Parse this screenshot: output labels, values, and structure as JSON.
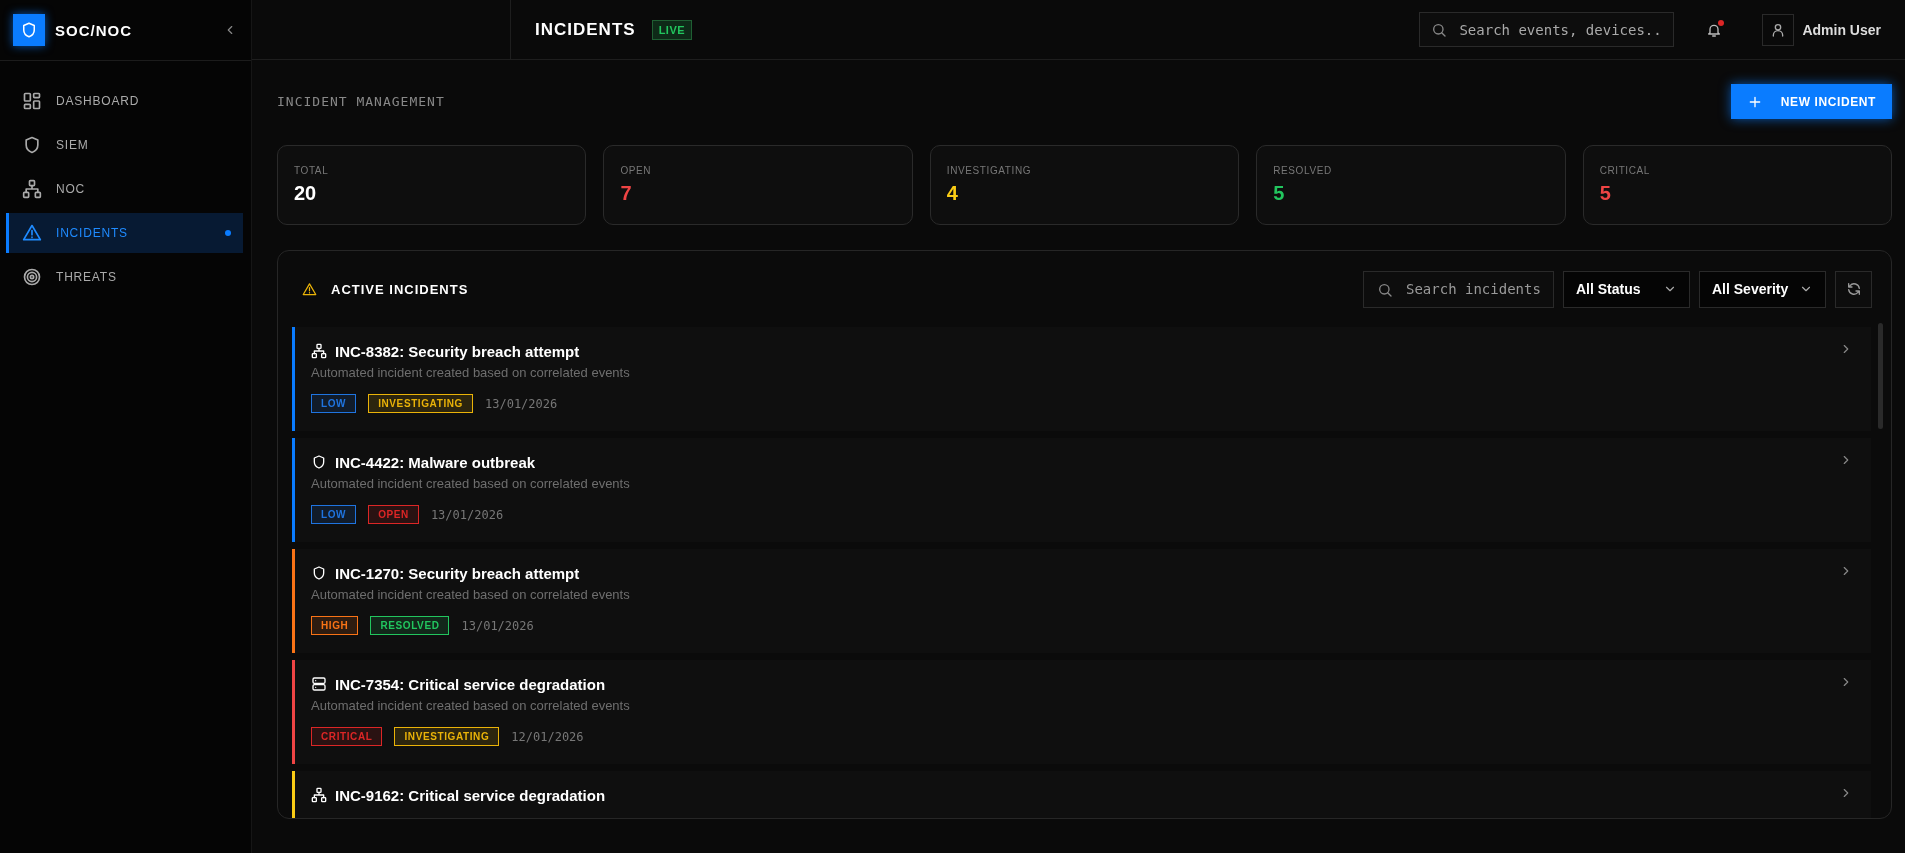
{
  "sidebar": {
    "brand": "SOC/NOC",
    "items": [
      {
        "label": "DASHBOARD",
        "selected": false
      },
      {
        "label": "SIEM",
        "selected": false
      },
      {
        "label": "NOC",
        "selected": false
      },
      {
        "label": "INCIDENTS",
        "selected": true
      },
      {
        "label": "THREATS",
        "selected": false
      }
    ]
  },
  "header": {
    "title": "INCIDENTS",
    "badge": "LIVE",
    "search": {
      "placeholder": "Search events, devices.."
    },
    "notifications": {
      "unread": true
    },
    "user": "Admin User"
  },
  "page": {
    "title": "INCIDENT MANAGEMENT",
    "action": "NEW INCIDENT"
  },
  "stats": [
    {
      "label": "TOTAL",
      "value": "20",
      "color": "#ffffff"
    },
    {
      "label": "OPEN",
      "value": "7",
      "color": "#ef4444"
    },
    {
      "label": "INVESTIGATING",
      "value": "4",
      "color": "#facc15"
    },
    {
      "label": "RESOLVED",
      "value": "5",
      "color": "#22c55e"
    },
    {
      "label": "CRITICAL",
      "value": "5",
      "color": "#ef4444"
    }
  ],
  "panel": {
    "title": "ACTIVE INCIDENTS",
    "search": {
      "placeholder": "Search incidents"
    },
    "status_filter": "All Status",
    "severity_filter": "All Severity"
  },
  "incidents": [
    {
      "kind": "network",
      "color": "#0a7cff",
      "title": "INC-8382: Security breach attempt",
      "description": "Automated incident created based on correlated events",
      "severity": {
        "label": "LOW",
        "color": "#1f74e0"
      },
      "status": {
        "label": "INVESTIGATING",
        "color": "#eab308"
      },
      "date": "13/01/2026"
    },
    {
      "kind": "security",
      "color": "#0a7cff",
      "title": "INC-4422: Malware outbreak",
      "description": "Automated incident created based on correlated events",
      "severity": {
        "label": "LOW",
        "color": "#1f74e0"
      },
      "status": {
        "label": "OPEN",
        "color": "#dc2626"
      },
      "date": "13/01/2026"
    },
    {
      "kind": "security",
      "color": "#f97316",
      "title": "INC-1270: Security breach attempt",
      "description": "Automated incident created based on correlated events",
      "severity": {
        "label": "HIGH",
        "color": "#f97316"
      },
      "status": {
        "label": "RESOLVED",
        "color": "#22c55e"
      },
      "date": "13/01/2026"
    },
    {
      "kind": "server",
      "color": "#ef4444",
      "title": "INC-7354: Critical service degradation",
      "description": "Automated incident created based on correlated events",
      "severity": {
        "label": "CRITICAL",
        "color": "#dc2626"
      },
      "status": {
        "label": "INVESTIGATING",
        "color": "#eab308"
      },
      "date": "12/01/2026"
    },
    {
      "kind": "network",
      "color": "#facc15",
      "title": "INC-9162: Critical service degradation"
    }
  ]
}
